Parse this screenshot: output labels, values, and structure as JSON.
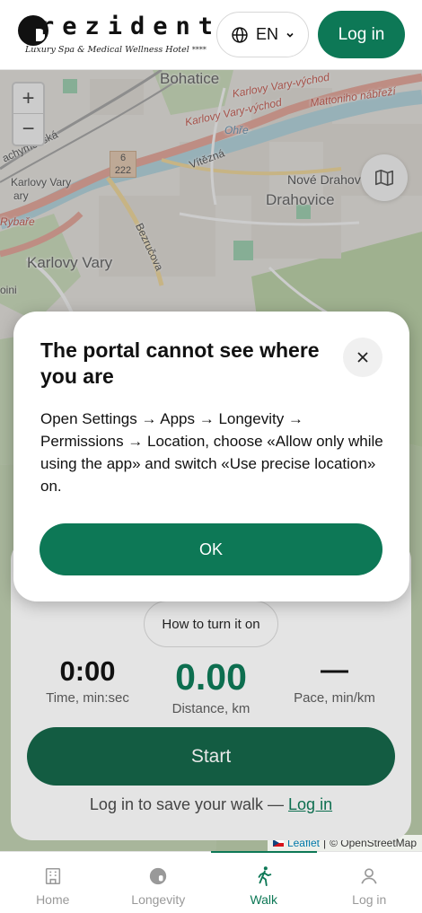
{
  "header": {
    "logo_word": "rezident",
    "logo_tagline": "Luxury Spa & Medical Wellness Hotel",
    "logo_stars": "****",
    "language": "EN",
    "login_label": "Log in"
  },
  "map": {
    "labels": {
      "bohatice": "Bohatice",
      "karlovy_vary_vychod_1": "Karlovy Vary-východ",
      "karlovy_vary_vychod_2": "Karlovy Vary-východ",
      "mattoniho": "Mattoniho nábřeží",
      "ohre": "Ohře",
      "vitezna": "Vítězná",
      "nove_drahovice": "Nové Drahov",
      "drahovice": "Drahovice",
      "karlovy_vary_left": "Karlovy Vary",
      "karlovy_vary_city": "Karlovy Vary",
      "rybare": "Rybaře",
      "bezrucova": "Bezručova",
      "achymovska": "achymovská",
      "road_6": "6",
      "road_222": "222",
      "voini": "oini",
      "vary": "ary"
    },
    "zoom_in": "+",
    "zoom_out": "−",
    "attribution_leaflet": "Leaflet",
    "attribution_sep": "|",
    "attribution_osm": "© OpenStreetMap"
  },
  "modal": {
    "title": "The portal cannot see where you are",
    "body": "Open Settings → Apps → Longevity → Permissions → Location, choose «Allow only while using the app» and switch «Use precise location» on.",
    "ok_label": "OK"
  },
  "walk": {
    "howto_label": "How to turn it on",
    "time_value": "0:00",
    "time_label": "Time, min:sec",
    "distance_value": "0.00",
    "distance_label": "Distance, km",
    "pace_value": "—",
    "pace_label": "Pace, min/km",
    "start_label": "Start",
    "save_text": "Log in to save your walk — ",
    "save_link": "Log in"
  },
  "nav": [
    {
      "label": "Home",
      "icon": "home-icon"
    },
    {
      "label": "Longevity",
      "icon": "longevity-icon"
    },
    {
      "label": "Walk",
      "icon": "walk-icon",
      "active": true
    },
    {
      "label": "Log in",
      "icon": "user-icon"
    }
  ],
  "colors": {
    "brand_green": "#0d7856",
    "start_green": "#135c42",
    "map_bg": "#eae7e0"
  }
}
